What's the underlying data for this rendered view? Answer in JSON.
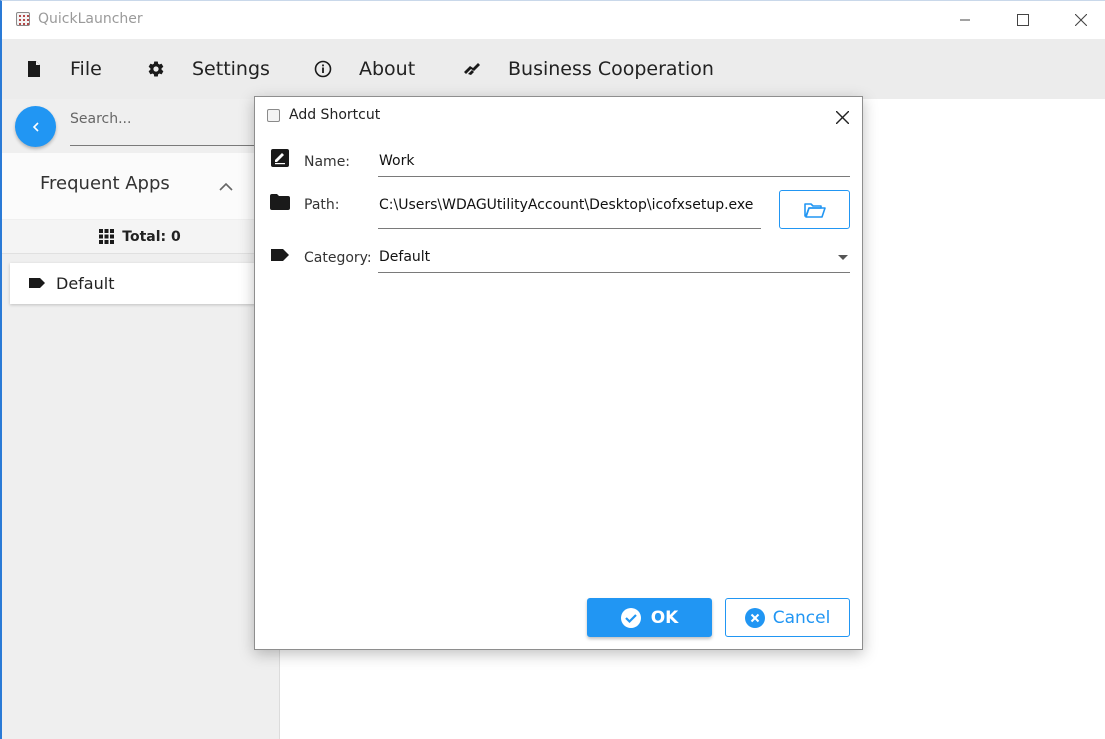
{
  "window": {
    "title": "QuickLauncher",
    "accent_color": "#2196f3"
  },
  "menu": {
    "items": [
      {
        "label": "File",
        "icon": "file-icon"
      },
      {
        "label": "Settings",
        "icon": "gear-icon"
      },
      {
        "label": "About",
        "icon": "info-icon"
      },
      {
        "label": "Business Cooperation",
        "icon": "handshake-icon"
      }
    ]
  },
  "sidebar": {
    "search_placeholder": "Search...",
    "frequent_apps_label": "Frequent Apps",
    "total_label": "Total: 0",
    "categories": [
      {
        "label": "Default",
        "icon": "tag-icon"
      }
    ]
  },
  "dialog": {
    "title": "Add Shortcut",
    "name_label": "Name:",
    "name_value": "Work",
    "path_label": "Path:",
    "path_value": "C:\\Users\\WDAGUtilityAccount\\Desktop\\icofxsetup.exe",
    "category_label": "Category:",
    "category_value": "Default",
    "ok_label": "OK",
    "cancel_label": "Cancel"
  }
}
